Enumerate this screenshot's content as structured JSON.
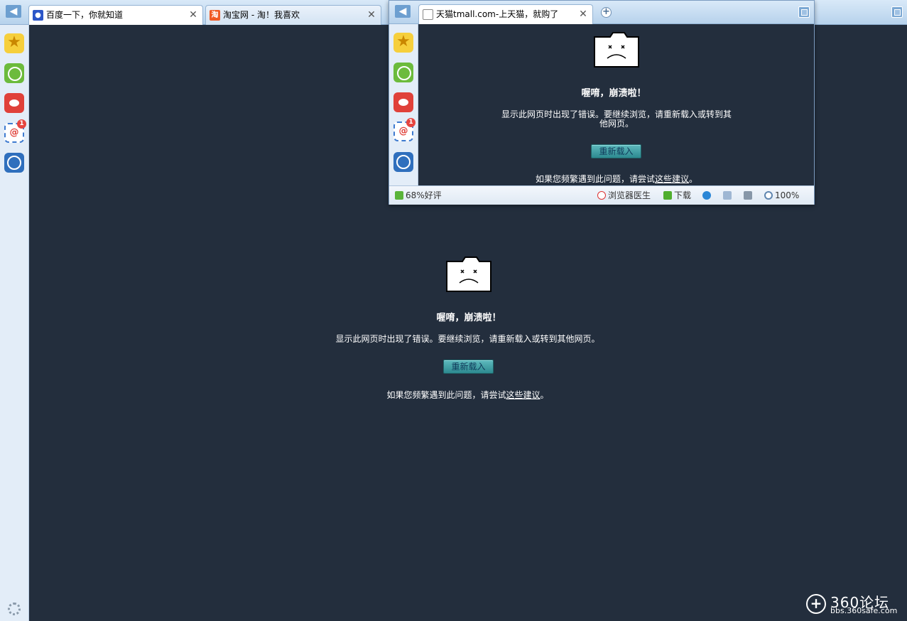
{
  "main_window": {
    "tabs": [
      {
        "label": "百度一下，你就知道",
        "favicon": "baidu-paw-icon",
        "active": true
      },
      {
        "label": "淘宝网 - 淘！我喜欢",
        "favicon": "taobao-icon",
        "favicon_text": "淘",
        "active": false
      }
    ],
    "close_glyph": "✕",
    "back_glyph": "◀"
  },
  "sidebar": {
    "items": [
      {
        "name": "favorites-star-icon"
      },
      {
        "name": "history-clock-icon"
      },
      {
        "name": "weibo-icon"
      },
      {
        "name": "mail-icon",
        "text": "@",
        "badge": "1"
      },
      {
        "name": "peace-app-icon"
      }
    ],
    "star_glyph": "★"
  },
  "crash": {
    "title": "喔唷，崩溃啦！",
    "message": "显示此网页时出现了错误。要继续浏览，请重新载入或转到其他网页。",
    "reload_label": "重新载入",
    "hint_prefix": "如果您频繁遇到此问题，请尝试",
    "hint_link": "这些建议",
    "hint_suffix": "。"
  },
  "popup_window": {
    "tab_label": "天猫tmall.com-上天猫，就购了",
    "new_tab_glyph": "+",
    "crash": {
      "title": "喔唷，崩溃啦！",
      "message_line1": "显示此网页时出现了错误。要继续浏览，请重新载入或转到其",
      "message_line2": "他网页。",
      "reload_label": "重新载入",
      "hint_prefix": "如果您频繁遇到此问题，请尝试",
      "hint_link": "这些建议",
      "hint_suffix": "。"
    },
    "statusbar": {
      "rating": "68%好评",
      "doctor": "浏览器医生",
      "download": "下载",
      "zoom": "100%"
    }
  },
  "watermark": {
    "title": "360论坛",
    "url": "bbs.360safe.com",
    "logo_glyph": "+"
  },
  "colors": {
    "page_background": "#232e3d",
    "tabstrip": "#b7d2ec",
    "reload_button": "#2d8a90"
  }
}
